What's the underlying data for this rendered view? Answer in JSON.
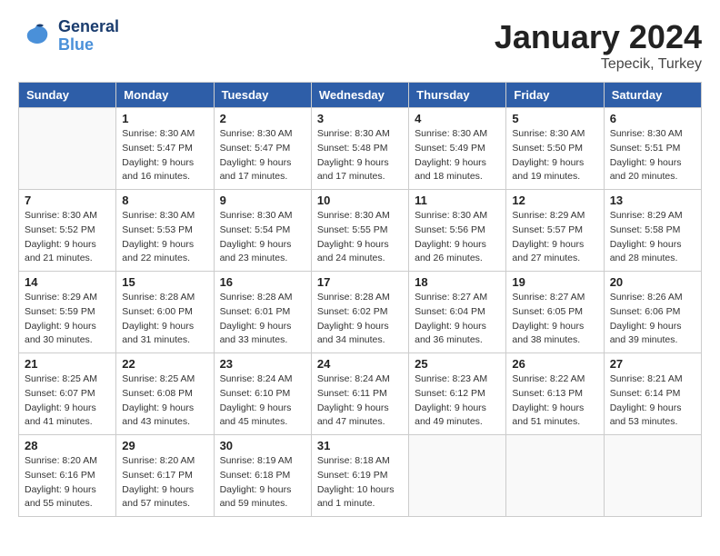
{
  "header": {
    "logo_general": "General",
    "logo_blue": "Blue",
    "month": "January 2024",
    "location": "Tepecik, Turkey"
  },
  "days_of_week": [
    "Sunday",
    "Monday",
    "Tuesday",
    "Wednesday",
    "Thursday",
    "Friday",
    "Saturday"
  ],
  "weeks": [
    [
      {
        "day": "",
        "details": []
      },
      {
        "day": "1",
        "details": [
          "Sunrise: 8:30 AM",
          "Sunset: 5:47 PM",
          "Daylight: 9 hours",
          "and 16 minutes."
        ]
      },
      {
        "day": "2",
        "details": [
          "Sunrise: 8:30 AM",
          "Sunset: 5:47 PM",
          "Daylight: 9 hours",
          "and 17 minutes."
        ]
      },
      {
        "day": "3",
        "details": [
          "Sunrise: 8:30 AM",
          "Sunset: 5:48 PM",
          "Daylight: 9 hours",
          "and 17 minutes."
        ]
      },
      {
        "day": "4",
        "details": [
          "Sunrise: 8:30 AM",
          "Sunset: 5:49 PM",
          "Daylight: 9 hours",
          "and 18 minutes."
        ]
      },
      {
        "day": "5",
        "details": [
          "Sunrise: 8:30 AM",
          "Sunset: 5:50 PM",
          "Daylight: 9 hours",
          "and 19 minutes."
        ]
      },
      {
        "day": "6",
        "details": [
          "Sunrise: 8:30 AM",
          "Sunset: 5:51 PM",
          "Daylight: 9 hours",
          "and 20 minutes."
        ]
      }
    ],
    [
      {
        "day": "7",
        "details": [
          "Sunrise: 8:30 AM",
          "Sunset: 5:52 PM",
          "Daylight: 9 hours",
          "and 21 minutes."
        ]
      },
      {
        "day": "8",
        "details": [
          "Sunrise: 8:30 AM",
          "Sunset: 5:53 PM",
          "Daylight: 9 hours",
          "and 22 minutes."
        ]
      },
      {
        "day": "9",
        "details": [
          "Sunrise: 8:30 AM",
          "Sunset: 5:54 PM",
          "Daylight: 9 hours",
          "and 23 minutes."
        ]
      },
      {
        "day": "10",
        "details": [
          "Sunrise: 8:30 AM",
          "Sunset: 5:55 PM",
          "Daylight: 9 hours",
          "and 24 minutes."
        ]
      },
      {
        "day": "11",
        "details": [
          "Sunrise: 8:30 AM",
          "Sunset: 5:56 PM",
          "Daylight: 9 hours",
          "and 26 minutes."
        ]
      },
      {
        "day": "12",
        "details": [
          "Sunrise: 8:29 AM",
          "Sunset: 5:57 PM",
          "Daylight: 9 hours",
          "and 27 minutes."
        ]
      },
      {
        "day": "13",
        "details": [
          "Sunrise: 8:29 AM",
          "Sunset: 5:58 PM",
          "Daylight: 9 hours",
          "and 28 minutes."
        ]
      }
    ],
    [
      {
        "day": "14",
        "details": [
          "Sunrise: 8:29 AM",
          "Sunset: 5:59 PM",
          "Daylight: 9 hours",
          "and 30 minutes."
        ]
      },
      {
        "day": "15",
        "details": [
          "Sunrise: 8:28 AM",
          "Sunset: 6:00 PM",
          "Daylight: 9 hours",
          "and 31 minutes."
        ]
      },
      {
        "day": "16",
        "details": [
          "Sunrise: 8:28 AM",
          "Sunset: 6:01 PM",
          "Daylight: 9 hours",
          "and 33 minutes."
        ]
      },
      {
        "day": "17",
        "details": [
          "Sunrise: 8:28 AM",
          "Sunset: 6:02 PM",
          "Daylight: 9 hours",
          "and 34 minutes."
        ]
      },
      {
        "day": "18",
        "details": [
          "Sunrise: 8:27 AM",
          "Sunset: 6:04 PM",
          "Daylight: 9 hours",
          "and 36 minutes."
        ]
      },
      {
        "day": "19",
        "details": [
          "Sunrise: 8:27 AM",
          "Sunset: 6:05 PM",
          "Daylight: 9 hours",
          "and 38 minutes."
        ]
      },
      {
        "day": "20",
        "details": [
          "Sunrise: 8:26 AM",
          "Sunset: 6:06 PM",
          "Daylight: 9 hours",
          "and 39 minutes."
        ]
      }
    ],
    [
      {
        "day": "21",
        "details": [
          "Sunrise: 8:25 AM",
          "Sunset: 6:07 PM",
          "Daylight: 9 hours",
          "and 41 minutes."
        ]
      },
      {
        "day": "22",
        "details": [
          "Sunrise: 8:25 AM",
          "Sunset: 6:08 PM",
          "Daylight: 9 hours",
          "and 43 minutes."
        ]
      },
      {
        "day": "23",
        "details": [
          "Sunrise: 8:24 AM",
          "Sunset: 6:10 PM",
          "Daylight: 9 hours",
          "and 45 minutes."
        ]
      },
      {
        "day": "24",
        "details": [
          "Sunrise: 8:24 AM",
          "Sunset: 6:11 PM",
          "Daylight: 9 hours",
          "and 47 minutes."
        ]
      },
      {
        "day": "25",
        "details": [
          "Sunrise: 8:23 AM",
          "Sunset: 6:12 PM",
          "Daylight: 9 hours",
          "and 49 minutes."
        ]
      },
      {
        "day": "26",
        "details": [
          "Sunrise: 8:22 AM",
          "Sunset: 6:13 PM",
          "Daylight: 9 hours",
          "and 51 minutes."
        ]
      },
      {
        "day": "27",
        "details": [
          "Sunrise: 8:21 AM",
          "Sunset: 6:14 PM",
          "Daylight: 9 hours",
          "and 53 minutes."
        ]
      }
    ],
    [
      {
        "day": "28",
        "details": [
          "Sunrise: 8:20 AM",
          "Sunset: 6:16 PM",
          "Daylight: 9 hours",
          "and 55 minutes."
        ]
      },
      {
        "day": "29",
        "details": [
          "Sunrise: 8:20 AM",
          "Sunset: 6:17 PM",
          "Daylight: 9 hours",
          "and 57 minutes."
        ]
      },
      {
        "day": "30",
        "details": [
          "Sunrise: 8:19 AM",
          "Sunset: 6:18 PM",
          "Daylight: 9 hours",
          "and 59 minutes."
        ]
      },
      {
        "day": "31",
        "details": [
          "Sunrise: 8:18 AM",
          "Sunset: 6:19 PM",
          "Daylight: 10 hours",
          "and 1 minute."
        ]
      },
      {
        "day": "",
        "details": []
      },
      {
        "day": "",
        "details": []
      },
      {
        "day": "",
        "details": []
      }
    ]
  ]
}
